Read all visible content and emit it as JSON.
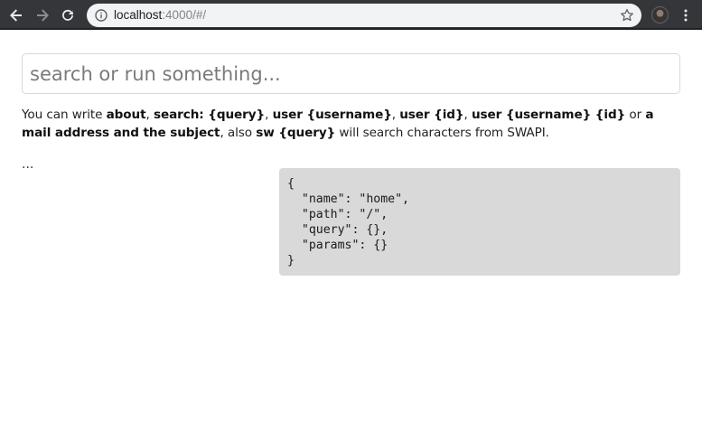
{
  "browser": {
    "url_host": "localhost",
    "url_rest": ":4000/#/"
  },
  "search": {
    "placeholder": "search or run something..."
  },
  "help": {
    "t1": "You can write ",
    "b1": "about",
    "t2": ", ",
    "b2": "search: {query}",
    "t3": ", ",
    "b3": "user {username}",
    "t4": ", ",
    "b4": "user {id}",
    "t5": ", ",
    "b5": "user {username} {id}",
    "t6": " or ",
    "b6": "a mail address and the subject",
    "t7": ", also ",
    "b7": "sw {query}",
    "t8": " will search characters from SWAPI."
  },
  "result_indicator": "...",
  "route_json": "{\n  \"name\": \"home\",\n  \"path\": \"/\",\n  \"query\": {},\n  \"params\": {}\n}"
}
